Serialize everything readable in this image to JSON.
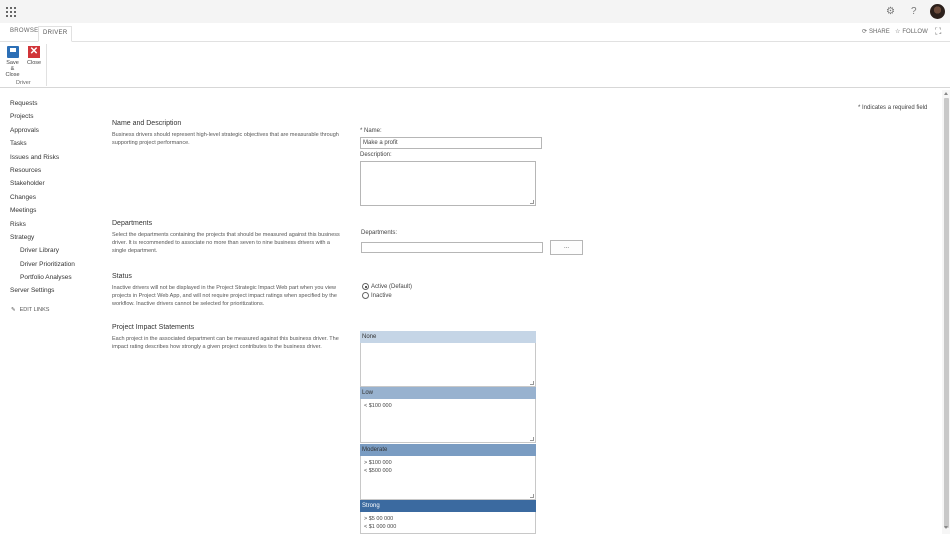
{
  "suitebar": {
    "icons": [
      "app-launcher-icon",
      "gear-icon",
      "help-icon",
      "avatar"
    ],
    "help_glyph": "?"
  },
  "ribbon": {
    "tabs": [
      "BROWSE",
      "DRIVER"
    ],
    "share_label": "SHARE",
    "follow_label": "FOLLOW",
    "save_close_label": "Save & Close",
    "close_label": "Close",
    "group_label": "Driver"
  },
  "quicklaunch": {
    "items": [
      "Requests",
      "Projects",
      "Approvals",
      "Tasks",
      "Issues and Risks",
      "Resources",
      "Stakeholder",
      "Changes",
      "Meetings",
      "Risks",
      "Strategy"
    ],
    "strategy_sub": [
      "Driver Library",
      "Driver Prioritization",
      "Portfolio Analyses"
    ],
    "server_settings": "Server Settings",
    "edit_links": "EDIT LINKS"
  },
  "required_note": "Indicates a required field",
  "sections": {
    "name_desc": {
      "title": "Name and Description",
      "desc": "Business drivers should represent high-level strategic objectives that are measurable through supporting project performance.",
      "name_label": "Name:",
      "name_value": "Make a profit",
      "description_label": "Description:",
      "description_value": ""
    },
    "departments": {
      "title": "Departments",
      "desc": "Select the departments containing the projects that should be measured against this business driver. It is recommended to associate no more than seven to nine business drivers with a single department.",
      "label": "Departments:",
      "value": "",
      "browse_button": "..."
    },
    "status": {
      "title": "Status",
      "desc": "Inactive drivers will not be displayed in the Project Strategic Impact Web part when you view projects in Project Web App, and will not require project impact ratings when specified by the workflow. Inactive drivers cannot be selected for prioritizations.",
      "options": [
        "Active (Default)",
        "Inactive"
      ],
      "selected": "Active (Default)"
    },
    "impact": {
      "title": "Project Impact Statements",
      "desc": "Each project in the associated department can be measured against this business driver. The impact rating describes how strongly a given project contributes to the business driver.",
      "levels": [
        {
          "name": "None",
          "lines": []
        },
        {
          "name": "Low",
          "lines": [
            "< $100 000"
          ]
        },
        {
          "name": "Moderate",
          "lines": [
            "> $100 000",
            "< $500 000"
          ]
        },
        {
          "name": "Strong",
          "lines": [
            "> $5 00 000",
            "< $1 000 000"
          ]
        }
      ]
    }
  }
}
